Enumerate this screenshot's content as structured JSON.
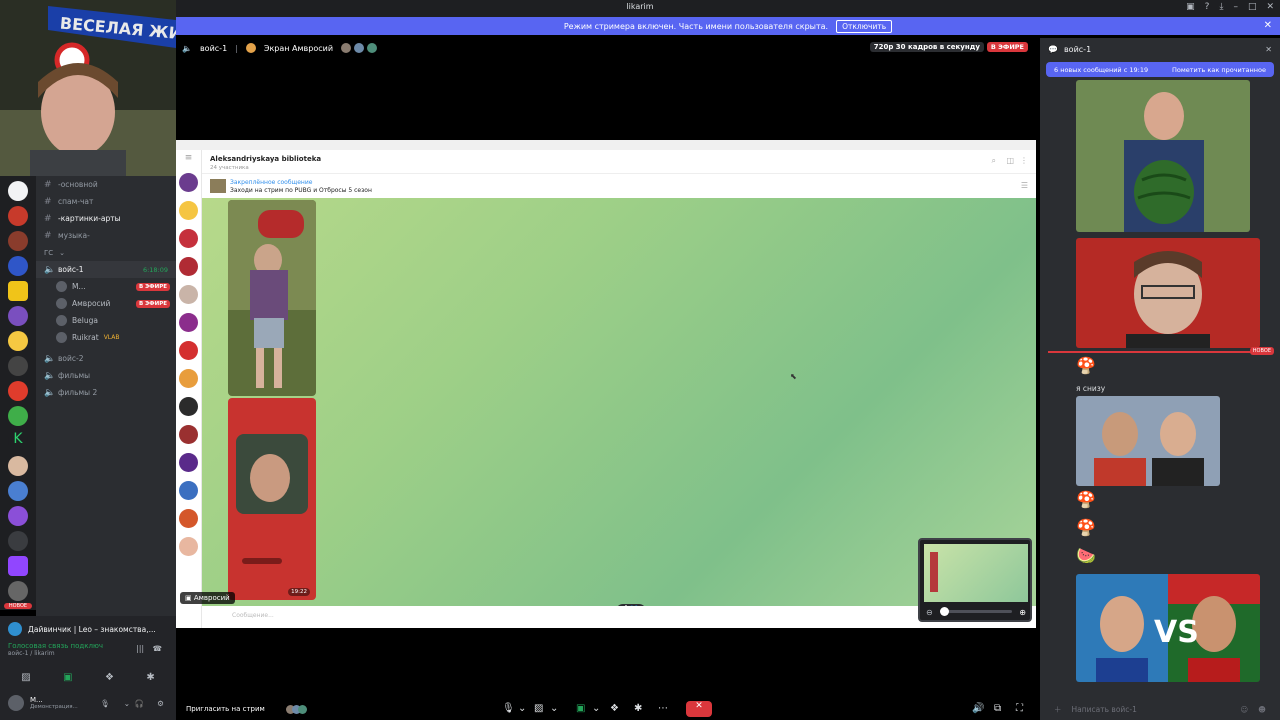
{
  "window": {
    "title": "likarim"
  },
  "streamer_banner": {
    "text": "Режим стримера включен. Часть имени пользователя скрыта.",
    "button": "Отключить"
  },
  "stream_header": {
    "channel": "войс-1",
    "screen_label": "Экран Амвросий",
    "quality": "720p 30 кадров в секунду",
    "live": "В ЭФИРЕ"
  },
  "sidebar": {
    "channels": [
      {
        "name": "-основной",
        "type": "text"
      },
      {
        "name": "спам-чат",
        "type": "text"
      },
      {
        "name": "-картинки-арты",
        "type": "text"
      },
      {
        "name": "музыка-",
        "type": "text"
      }
    ],
    "voice_category": "ГС",
    "active_voice": {
      "name": "войс-1",
      "timer": "6:18:09"
    },
    "voice_users": [
      {
        "name": "М...",
        "live": "В ЭФИРЕ"
      },
      {
        "name": "Амвросий",
        "live": "В ЭФИРЕ"
      },
      {
        "name": "Beluga",
        "live": ""
      },
      {
        "name": "Ruikrat",
        "live": "",
        "tag": "VLAB"
      }
    ],
    "other_voice": [
      "войс-2",
      "фильмы",
      "фильмы 2"
    ],
    "server_badge": "НОВОЕ"
  },
  "user_panel": {
    "activity": "Дайвинчик | Leo – знакомства,...",
    "voice_status": "Голосовая связь подключ",
    "voice_sub": "войс-1 / likarim",
    "username": "М...",
    "user_sub": "Демонстрация..."
  },
  "telegram": {
    "chat_title": "Aleksandriyskaya biblioteka",
    "members": "24 участника",
    "pinned_label": "Закреплённое сообщение",
    "pinned_text": "Заходи на стрим по PUBG и Отбросы 5 сезон",
    "photo_time": "19:22",
    "input_placeholder": "Сообщение..."
  },
  "stream_overlay": {
    "presenter": "Амвросий"
  },
  "bottom_bar": {
    "invite": "Пригласить на стрим"
  },
  "chat": {
    "channel": "войс-1",
    "new_messages": "6 новых сообщений с 19:19",
    "mark_read": "Пометить как прочитанное",
    "new_divider": "НОВОЕ",
    "message": "я снизу",
    "input_placeholder": "Написать войс-1"
  },
  "colors": {
    "blurple": "#5865f2",
    "live_red": "#da373c",
    "bg": "#2b2d31"
  }
}
